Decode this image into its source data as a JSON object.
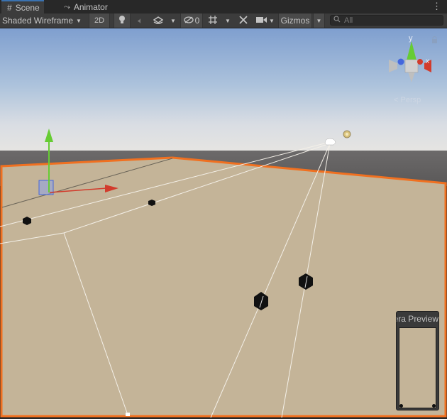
{
  "tabs": [
    {
      "label": "Scene",
      "icon": "hash-grid-icon"
    },
    {
      "label": "Animator",
      "icon": "animator-icon"
    }
  ],
  "toolbar": {
    "shading_mode": "Shaded Wireframe",
    "mode_2d": "2D",
    "hidden_count": "0",
    "gizmos_label": "Gizmos",
    "search_placeholder": "All"
  },
  "scene": {
    "orientation_gizmo": {
      "y_label": "y",
      "x_label": "x",
      "persp_label": "Persp"
    },
    "camera_preview_title": "Camera Preview"
  },
  "colors": {
    "selection_outline": "#f07020",
    "ground": "#c4b498",
    "x_axis": "#d23b2c",
    "y_axis": "#66cc33",
    "z_axis": "#4466dd"
  }
}
